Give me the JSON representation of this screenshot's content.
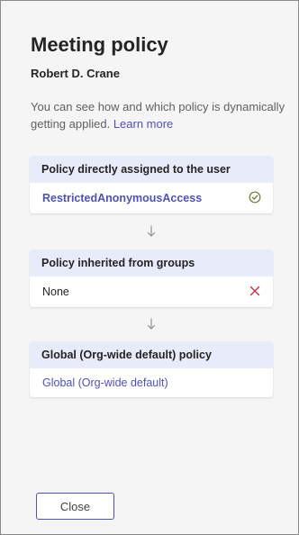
{
  "dialog": {
    "title": "Meeting policy",
    "user_name": "Robert D. Crane",
    "description": "You can see how and which policy is dynamically getting applied.",
    "learn_more": "Learn more"
  },
  "cards": [
    {
      "header": "Policy directly assigned to the user",
      "value": "RestrictedAnonymousAccess",
      "status_icon": "check-circle-icon"
    },
    {
      "header": "Policy inherited from groups",
      "value": "None",
      "status_icon": "x-icon"
    },
    {
      "header": "Global (Org-wide default) policy",
      "value": "Global (Org-wide default)"
    }
  ],
  "footer": {
    "close_label": "Close"
  },
  "colors": {
    "accent": "#4f52b2",
    "header_bg": "#e8ebfa",
    "check_color": "#6b7b3a",
    "x_color": "#c4314b"
  }
}
